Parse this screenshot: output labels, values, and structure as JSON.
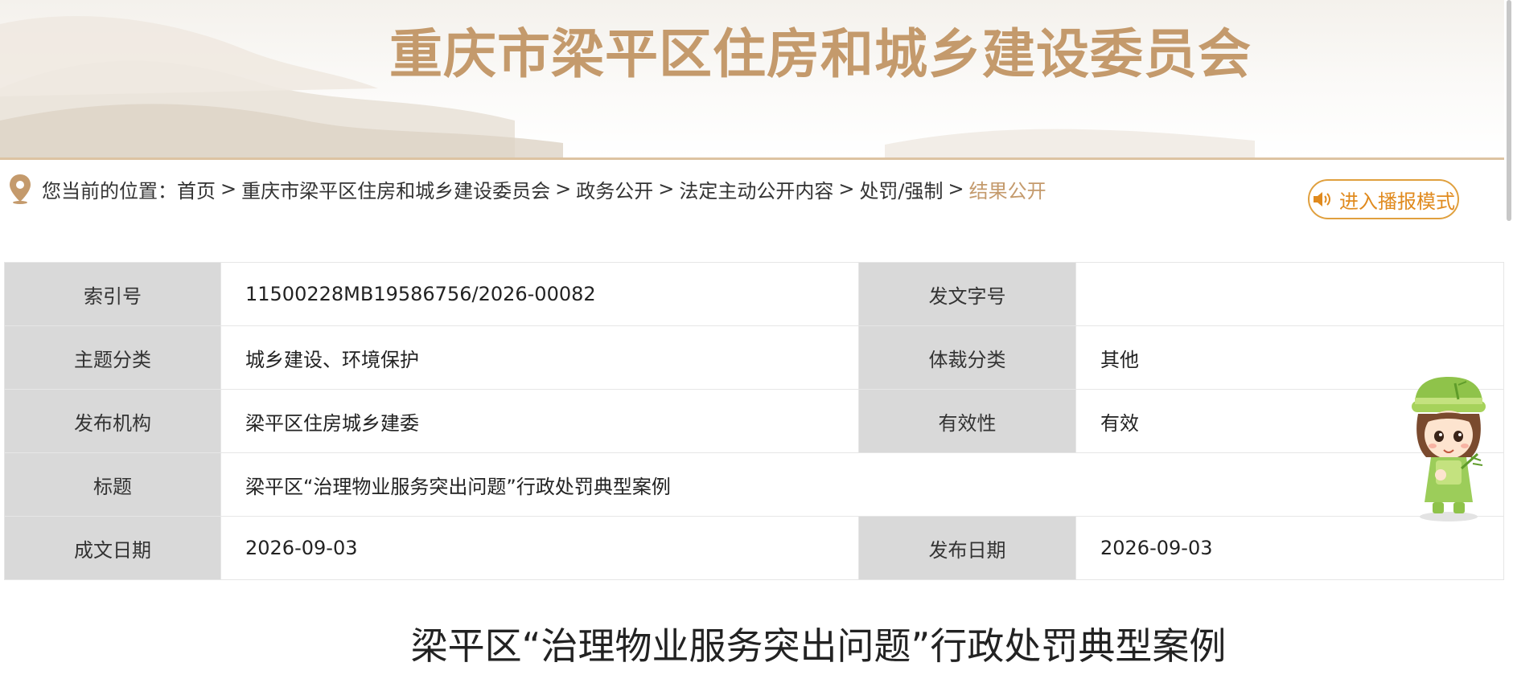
{
  "header": {
    "site_title": "重庆市梁平区住房和城乡建设委员会"
  },
  "breadcrumb": {
    "prefix": "您当前的位置：",
    "items": [
      "首页",
      "重庆市梁平区住房和城乡建设委员会",
      "政务公开",
      "法定主动公开内容",
      "处罚/强制"
    ],
    "current": "结果公开",
    "separator": ">"
  },
  "broadcast_button": {
    "label": "进入播报模式",
    "icon": "speaker-icon"
  },
  "meta": {
    "index_no": {
      "label": "索引号",
      "value": "11500228MB19586756/2026-00082"
    },
    "doc_no": {
      "label": "发文字号",
      "value": ""
    },
    "topic": {
      "label": "主题分类",
      "value": "城乡建设、环境保护"
    },
    "genre": {
      "label": "体裁分类",
      "value": "其他"
    },
    "publisher": {
      "label": "发布机构",
      "value": "梁平区住房城乡建委"
    },
    "validity": {
      "label": "有效性",
      "value": "有效"
    },
    "title": {
      "label": "标题",
      "value": "梁平区“治理物业服务突出问题”行政处罚典型案例"
    },
    "written_date": {
      "label": "成文日期",
      "value": "2026-09-03"
    },
    "publish_date": {
      "label": "发布日期",
      "value": "2026-09-03"
    }
  },
  "article": {
    "title": "梁平区“治理物业服务突出问题”行政处罚典型案例"
  },
  "colors": {
    "accent": "#c49a6c",
    "button": "#e08a1e",
    "label_bg": "#d9d9d9"
  }
}
